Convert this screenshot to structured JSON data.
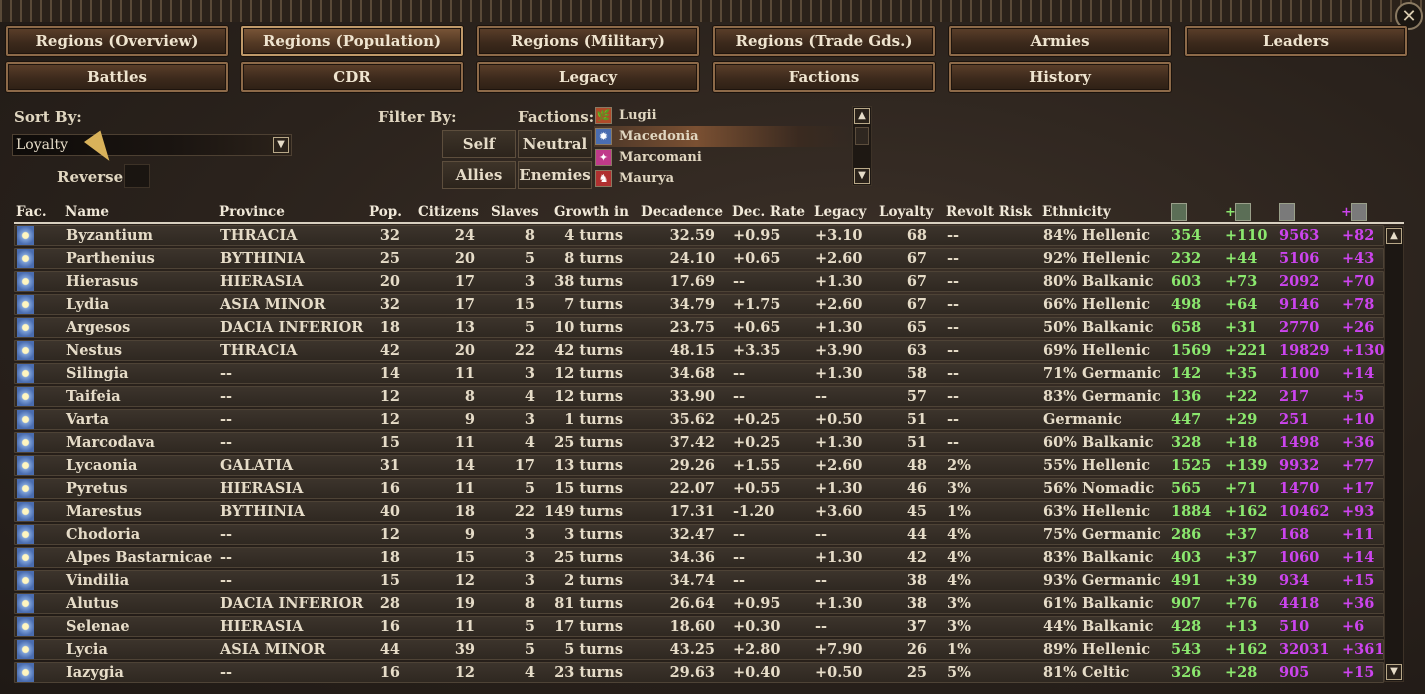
{
  "window": {
    "close_label": "✕"
  },
  "tabs_row1": [
    "Regions (Overview)",
    "Regions (Population)",
    "Regions (Military)",
    "Regions (Trade Gds.)",
    "Armies",
    "Leaders"
  ],
  "tabs_row2": [
    "Battles",
    "CDR",
    "Legacy",
    "Factions",
    "History"
  ],
  "active_tab": "Regions (Population)",
  "sort": {
    "label": "Sort By:",
    "value": "Loyalty",
    "reverse_label": "Reverse",
    "reverse_checked": false
  },
  "filter": {
    "label": "Filter By:",
    "buttons": [
      "Self",
      "Neutral",
      "Allies",
      "Enemies"
    ]
  },
  "factions": {
    "label": "Factions:",
    "items": [
      {
        "name": "Lugii",
        "icon": "🌿",
        "color": "#b04a2a"
      },
      {
        "name": "Macedonia",
        "icon": "✹",
        "color": "#4a6db0",
        "selected": true
      },
      {
        "name": "Marcomani",
        "icon": "✦",
        "color": "#c03a8a"
      },
      {
        "name": "Maurya",
        "icon": "♞",
        "color": "#b03030"
      }
    ]
  },
  "columns": {
    "fac": "Fac.",
    "name": "Name",
    "province": "Province",
    "pop": "Pop.",
    "citizens": "Citizens",
    "slaves": "Slaves",
    "growth": "Growth in",
    "decadence": "Decadence",
    "dec_rate": "Dec. Rate",
    "legacy": "Legacy",
    "loyalty": "Loyalty",
    "revolt": "Revolt Risk",
    "ethnicity": "Ethnicity",
    "plus1": "+",
    "plus2": "+",
    "icons": [
      "population-icon",
      "population-growth-icon",
      "treasury-icon",
      "treasury-growth-icon"
    ]
  },
  "rows": [
    [
      "Byzantium",
      "THRACIA",
      "32",
      "24",
      "8",
      "4 turns",
      "32.59",
      "+0.95",
      "+3.10",
      "68",
      "--",
      "84% Hellenic",
      "354",
      "+110",
      "9563",
      "+82"
    ],
    [
      "Parthenius",
      "BYTHINIA",
      "25",
      "20",
      "5",
      "8 turns",
      "24.10",
      "+0.65",
      "+2.60",
      "67",
      "--",
      "92% Hellenic",
      "232",
      "+44",
      "5106",
      "+43"
    ],
    [
      "Hierasus",
      "HIERASIA",
      "20",
      "17",
      "3",
      "38 turns",
      "17.69",
      "--",
      "+1.30",
      "67",
      "--",
      "80% Balkanic",
      "603",
      "+73",
      "2092",
      "+70"
    ],
    [
      "Lydia",
      "ASIA MINOR",
      "32",
      "17",
      "15",
      "7 turns",
      "34.79",
      "+1.75",
      "+2.60",
      "67",
      "--",
      "66% Hellenic",
      "498",
      "+64",
      "9146",
      "+78"
    ],
    [
      "Argesos",
      "DACIA INFERIOR",
      "18",
      "13",
      "5",
      "10 turns",
      "23.75",
      "+0.65",
      "+1.30",
      "65",
      "--",
      "50% Balkanic",
      "658",
      "+31",
      "2770",
      "+26"
    ],
    [
      "Nestus",
      "THRACIA",
      "42",
      "20",
      "22",
      "42 turns",
      "48.15",
      "+3.35",
      "+3.90",
      "63",
      "--",
      "69% Hellenic",
      "1569",
      "+221",
      "19829",
      "+130"
    ],
    [
      "Silingia",
      "--",
      "14",
      "11",
      "3",
      "12 turns",
      "34.68",
      "--",
      "+1.30",
      "58",
      "--",
      "71% Germanic",
      "142",
      "+35",
      "1100",
      "+14"
    ],
    [
      "Taifeia",
      "--",
      "12",
      "8",
      "4",
      "12 turns",
      "33.90",
      "--",
      "--",
      "57",
      "--",
      "83% Germanic",
      "136",
      "+22",
      "217",
      "+5"
    ],
    [
      "Varta",
      "--",
      "12",
      "9",
      "3",
      "1 turns",
      "35.62",
      "+0.25",
      "+0.50",
      "51",
      "--",
      "Germanic",
      "447",
      "+29",
      "251",
      "+10"
    ],
    [
      "Marcodava",
      "--",
      "15",
      "11",
      "4",
      "25 turns",
      "37.42",
      "+0.25",
      "+1.30",
      "51",
      "--",
      "60% Balkanic",
      "328",
      "+18",
      "1498",
      "+36"
    ],
    [
      "Lycaonia",
      "GALATIA",
      "31",
      "14",
      "17",
      "13 turns",
      "29.26",
      "+1.55",
      "+2.60",
      "48",
      "2%",
      "55% Hellenic",
      "1525",
      "+139",
      "9932",
      "+77"
    ],
    [
      "Pyretus",
      "HIERASIA",
      "16",
      "11",
      "5",
      "15 turns",
      "22.07",
      "+0.55",
      "+1.30",
      "46",
      "3%",
      "56% Nomadic",
      "565",
      "+71",
      "1470",
      "+17"
    ],
    [
      "Marestus",
      "BYTHINIA",
      "40",
      "18",
      "22",
      "149 turns",
      "17.31",
      "-1.20",
      "+3.60",
      "45",
      "1%",
      "63% Hellenic",
      "1884",
      "+162",
      "10462",
      "+93"
    ],
    [
      "Chodoria",
      "--",
      "12",
      "9",
      "3",
      "3 turns",
      "32.47",
      "--",
      "--",
      "44",
      "4%",
      "75% Germanic",
      "286",
      "+37",
      "168",
      "+11"
    ],
    [
      "Alpes Bastarnicae",
      "--",
      "18",
      "15",
      "3",
      "25 turns",
      "34.36",
      "--",
      "+1.30",
      "42",
      "4%",
      "83% Balkanic",
      "403",
      "+37",
      "1060",
      "+14"
    ],
    [
      "Vindilia",
      "--",
      "15",
      "12",
      "3",
      "2 turns",
      "34.74",
      "--",
      "--",
      "38",
      "4%",
      "93% Germanic",
      "491",
      "+39",
      "934",
      "+15"
    ],
    [
      "Alutus",
      "DACIA INFERIOR",
      "28",
      "19",
      "8",
      "81 turns",
      "26.64",
      "+0.95",
      "+1.30",
      "38",
      "3%",
      "61% Balkanic",
      "907",
      "+76",
      "4418",
      "+36"
    ],
    [
      "Selenae",
      "HIERASIA",
      "16",
      "11",
      "5",
      "17 turns",
      "18.60",
      "+0.30",
      "--",
      "37",
      "3%",
      "44% Balkanic",
      "428",
      "+13",
      "510",
      "+6"
    ],
    [
      "Lycia",
      "ASIA MINOR",
      "44",
      "39",
      "5",
      "5 turns",
      "43.25",
      "+2.80",
      "+7.90",
      "26",
      "1%",
      "89% Hellenic",
      "543",
      "+162",
      "32031",
      "+361"
    ],
    [
      "Iazygia",
      "--",
      "16",
      "12",
      "4",
      "23 turns",
      "29.63",
      "+0.40",
      "+0.50",
      "25",
      "5%",
      "81% Celtic",
      "326",
      "+28",
      "905",
      "+15"
    ]
  ]
}
